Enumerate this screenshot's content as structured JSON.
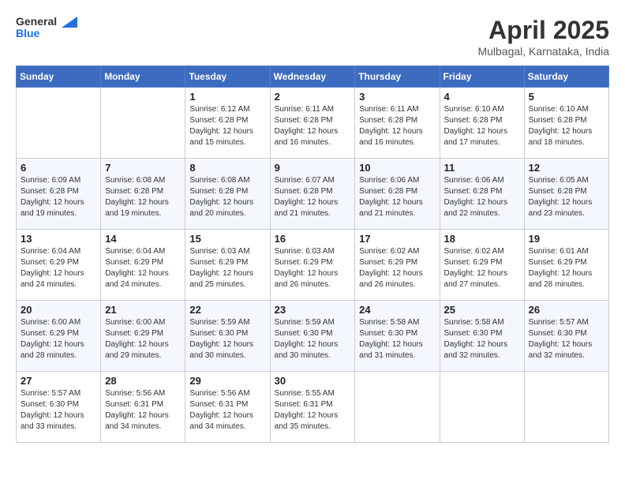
{
  "header": {
    "logo_line1": "General",
    "logo_line2": "Blue",
    "month_year": "April 2025",
    "location": "Mulbagal, Karnataka, India"
  },
  "weekdays": [
    "Sunday",
    "Monday",
    "Tuesday",
    "Wednesday",
    "Thursday",
    "Friday",
    "Saturday"
  ],
  "weeks": [
    [
      {
        "day": "",
        "sunrise": "",
        "sunset": "",
        "daylight": ""
      },
      {
        "day": "",
        "sunrise": "",
        "sunset": "",
        "daylight": ""
      },
      {
        "day": "1",
        "sunrise": "Sunrise: 6:12 AM",
        "sunset": "Sunset: 6:28 PM",
        "daylight": "Daylight: 12 hours and 15 minutes."
      },
      {
        "day": "2",
        "sunrise": "Sunrise: 6:11 AM",
        "sunset": "Sunset: 6:28 PM",
        "daylight": "Daylight: 12 hours and 16 minutes."
      },
      {
        "day": "3",
        "sunrise": "Sunrise: 6:11 AM",
        "sunset": "Sunset: 6:28 PM",
        "daylight": "Daylight: 12 hours and 16 minutes."
      },
      {
        "day": "4",
        "sunrise": "Sunrise: 6:10 AM",
        "sunset": "Sunset: 6:28 PM",
        "daylight": "Daylight: 12 hours and 17 minutes."
      },
      {
        "day": "5",
        "sunrise": "Sunrise: 6:10 AM",
        "sunset": "Sunset: 6:28 PM",
        "daylight": "Daylight: 12 hours and 18 minutes."
      }
    ],
    [
      {
        "day": "6",
        "sunrise": "Sunrise: 6:09 AM",
        "sunset": "Sunset: 6:28 PM",
        "daylight": "Daylight: 12 hours and 19 minutes."
      },
      {
        "day": "7",
        "sunrise": "Sunrise: 6:08 AM",
        "sunset": "Sunset: 6:28 PM",
        "daylight": "Daylight: 12 hours and 19 minutes."
      },
      {
        "day": "8",
        "sunrise": "Sunrise: 6:08 AM",
        "sunset": "Sunset: 6:28 PM",
        "daylight": "Daylight: 12 hours and 20 minutes."
      },
      {
        "day": "9",
        "sunrise": "Sunrise: 6:07 AM",
        "sunset": "Sunset: 6:28 PM",
        "daylight": "Daylight: 12 hours and 21 minutes."
      },
      {
        "day": "10",
        "sunrise": "Sunrise: 6:06 AM",
        "sunset": "Sunset: 6:28 PM",
        "daylight": "Daylight: 12 hours and 21 minutes."
      },
      {
        "day": "11",
        "sunrise": "Sunrise: 6:06 AM",
        "sunset": "Sunset: 6:28 PM",
        "daylight": "Daylight: 12 hours and 22 minutes."
      },
      {
        "day": "12",
        "sunrise": "Sunrise: 6:05 AM",
        "sunset": "Sunset: 6:28 PM",
        "daylight": "Daylight: 12 hours and 23 minutes."
      }
    ],
    [
      {
        "day": "13",
        "sunrise": "Sunrise: 6:04 AM",
        "sunset": "Sunset: 6:29 PM",
        "daylight": "Daylight: 12 hours and 24 minutes."
      },
      {
        "day": "14",
        "sunrise": "Sunrise: 6:04 AM",
        "sunset": "Sunset: 6:29 PM",
        "daylight": "Daylight: 12 hours and 24 minutes."
      },
      {
        "day": "15",
        "sunrise": "Sunrise: 6:03 AM",
        "sunset": "Sunset: 6:29 PM",
        "daylight": "Daylight: 12 hours and 25 minutes."
      },
      {
        "day": "16",
        "sunrise": "Sunrise: 6:03 AM",
        "sunset": "Sunset: 6:29 PM",
        "daylight": "Daylight: 12 hours and 26 minutes."
      },
      {
        "day": "17",
        "sunrise": "Sunrise: 6:02 AM",
        "sunset": "Sunset: 6:29 PM",
        "daylight": "Daylight: 12 hours and 26 minutes."
      },
      {
        "day": "18",
        "sunrise": "Sunrise: 6:02 AM",
        "sunset": "Sunset: 6:29 PM",
        "daylight": "Daylight: 12 hours and 27 minutes."
      },
      {
        "day": "19",
        "sunrise": "Sunrise: 6:01 AM",
        "sunset": "Sunset: 6:29 PM",
        "daylight": "Daylight: 12 hours and 28 minutes."
      }
    ],
    [
      {
        "day": "20",
        "sunrise": "Sunrise: 6:00 AM",
        "sunset": "Sunset: 6:29 PM",
        "daylight": "Daylight: 12 hours and 28 minutes."
      },
      {
        "day": "21",
        "sunrise": "Sunrise: 6:00 AM",
        "sunset": "Sunset: 6:29 PM",
        "daylight": "Daylight: 12 hours and 29 minutes."
      },
      {
        "day": "22",
        "sunrise": "Sunrise: 5:59 AM",
        "sunset": "Sunset: 6:30 PM",
        "daylight": "Daylight: 12 hours and 30 minutes."
      },
      {
        "day": "23",
        "sunrise": "Sunrise: 5:59 AM",
        "sunset": "Sunset: 6:30 PM",
        "daylight": "Daylight: 12 hours and 30 minutes."
      },
      {
        "day": "24",
        "sunrise": "Sunrise: 5:58 AM",
        "sunset": "Sunset: 6:30 PM",
        "daylight": "Daylight: 12 hours and 31 minutes."
      },
      {
        "day": "25",
        "sunrise": "Sunrise: 5:58 AM",
        "sunset": "Sunset: 6:30 PM",
        "daylight": "Daylight: 12 hours and 32 minutes."
      },
      {
        "day": "26",
        "sunrise": "Sunrise: 5:57 AM",
        "sunset": "Sunset: 6:30 PM",
        "daylight": "Daylight: 12 hours and 32 minutes."
      }
    ],
    [
      {
        "day": "27",
        "sunrise": "Sunrise: 5:57 AM",
        "sunset": "Sunset: 6:30 PM",
        "daylight": "Daylight: 12 hours and 33 minutes."
      },
      {
        "day": "28",
        "sunrise": "Sunrise: 5:56 AM",
        "sunset": "Sunset: 6:31 PM",
        "daylight": "Daylight: 12 hours and 34 minutes."
      },
      {
        "day": "29",
        "sunrise": "Sunrise: 5:56 AM",
        "sunset": "Sunset: 6:31 PM",
        "daylight": "Daylight: 12 hours and 34 minutes."
      },
      {
        "day": "30",
        "sunrise": "Sunrise: 5:55 AM",
        "sunset": "Sunset: 6:31 PM",
        "daylight": "Daylight: 12 hours and 35 minutes."
      },
      {
        "day": "",
        "sunrise": "",
        "sunset": "",
        "daylight": ""
      },
      {
        "day": "",
        "sunrise": "",
        "sunset": "",
        "daylight": ""
      },
      {
        "day": "",
        "sunrise": "",
        "sunset": "",
        "daylight": ""
      }
    ]
  ]
}
